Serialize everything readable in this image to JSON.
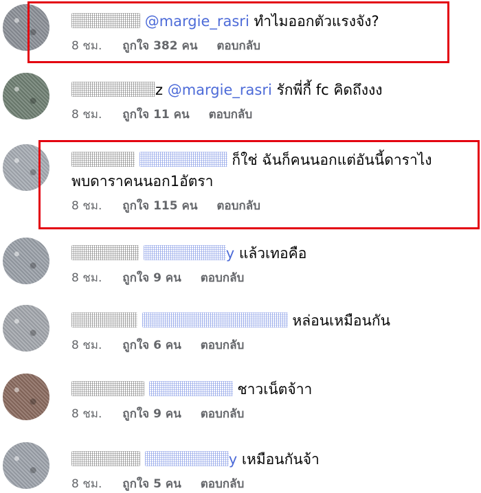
{
  "comments": [
    {
      "mention": "@margie_rasri",
      "text": "ทำไมออกตัวแรงจัง?",
      "time": "8 ชม.",
      "likes": "ถูกใจ 382 คน",
      "reply": "ตอบกลับ",
      "avatar_color": "#8b8f97"
    },
    {
      "name_suffix": "z",
      "mention": "@margie_rasri",
      "text": "รักพี่กี้ fc คิดถึงงง",
      "time": "8 ชม.",
      "likes": "ถูกใจ 11 คน",
      "reply": "ตอบกลับ",
      "avatar_color": "#6f7f72"
    },
    {
      "text": "ก็ใช่ ฉันก็คนนอกแต่อันนี้ดาราไง",
      "text2": "พบดาราคนนอก1อัตรา",
      "time": "8 ชม.",
      "likes": "ถูกใจ 115 คน",
      "reply": "ตอบกลับ",
      "avatar_color": "#a6abb3"
    },
    {
      "mention_tail": "y",
      "text": "แล้วเทอคือ",
      "time": "8 ชม.",
      "likes": "ถูกใจ 9 คน",
      "reply": "ตอบกลับ",
      "avatar_color": "#9aa0a8"
    },
    {
      "text": "หล่อนเหมือนกัน",
      "time": "8 ชม.",
      "likes": "ถูกใจ 6 คน",
      "reply": "ตอบกลับ",
      "avatar_color": "#a3a7ad"
    },
    {
      "text": "ชาวเน็ตจ้าา",
      "time": "8 ชม.",
      "likes": "ถูกใจ 9 คน",
      "reply": "ตอบกลับ",
      "avatar_color": "#8a6a5e"
    },
    {
      "mention_tail": "y",
      "text": "เหมือนกันจ้า",
      "time": "8 ชม.",
      "likes": "ถูกใจ 5 คน",
      "reply": "ตอบกลับ",
      "avatar_color": "#9da3ab"
    }
  ],
  "colors": {
    "mention": "#4d6bd8",
    "meta": "#65676b",
    "highlight": "#e3000f"
  }
}
